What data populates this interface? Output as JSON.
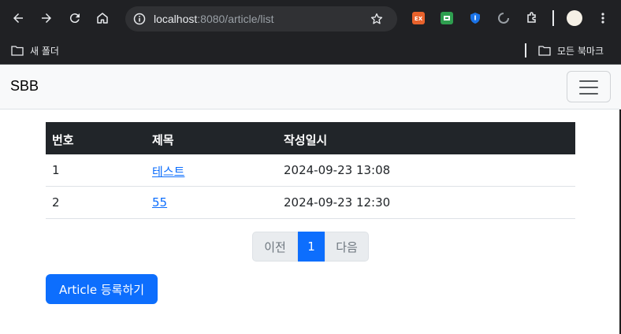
{
  "browser": {
    "url_host": "localhost",
    "url_rest": ":8080/article/list",
    "bookmarks": {
      "new_folder": "새 폴더",
      "all_bookmarks": "모든 북마크"
    },
    "icons": {
      "back": "back-arrow-icon",
      "forward": "forward-arrow-icon",
      "reload": "reload-icon",
      "home": "home-icon",
      "site_info": "site-info-icon",
      "bookmark_star": "star-icon",
      "extensions": "puzzle-icon",
      "menu": "kebab-menu-icon"
    },
    "ext_colors": [
      "#e8622c",
      "#2e9e4f",
      "#1a73e8",
      "#9aa0a6"
    ]
  },
  "navbar": {
    "brand": "SBB"
  },
  "table": {
    "headers": [
      "번호",
      "제목",
      "작성일시"
    ],
    "rows": [
      {
        "num": "1",
        "title": "테스트",
        "date": "2024-09-23 13:08"
      },
      {
        "num": "2",
        "title": "55",
        "date": "2024-09-23 12:30"
      }
    ]
  },
  "pagination": {
    "prev": "이전",
    "current": "1",
    "next": "다음"
  },
  "actions": {
    "create_label": "Article 등록하기"
  },
  "colors": {
    "primary": "#0d6efd",
    "table_header_bg": "#212529",
    "chrome_bg": "#202124"
  }
}
